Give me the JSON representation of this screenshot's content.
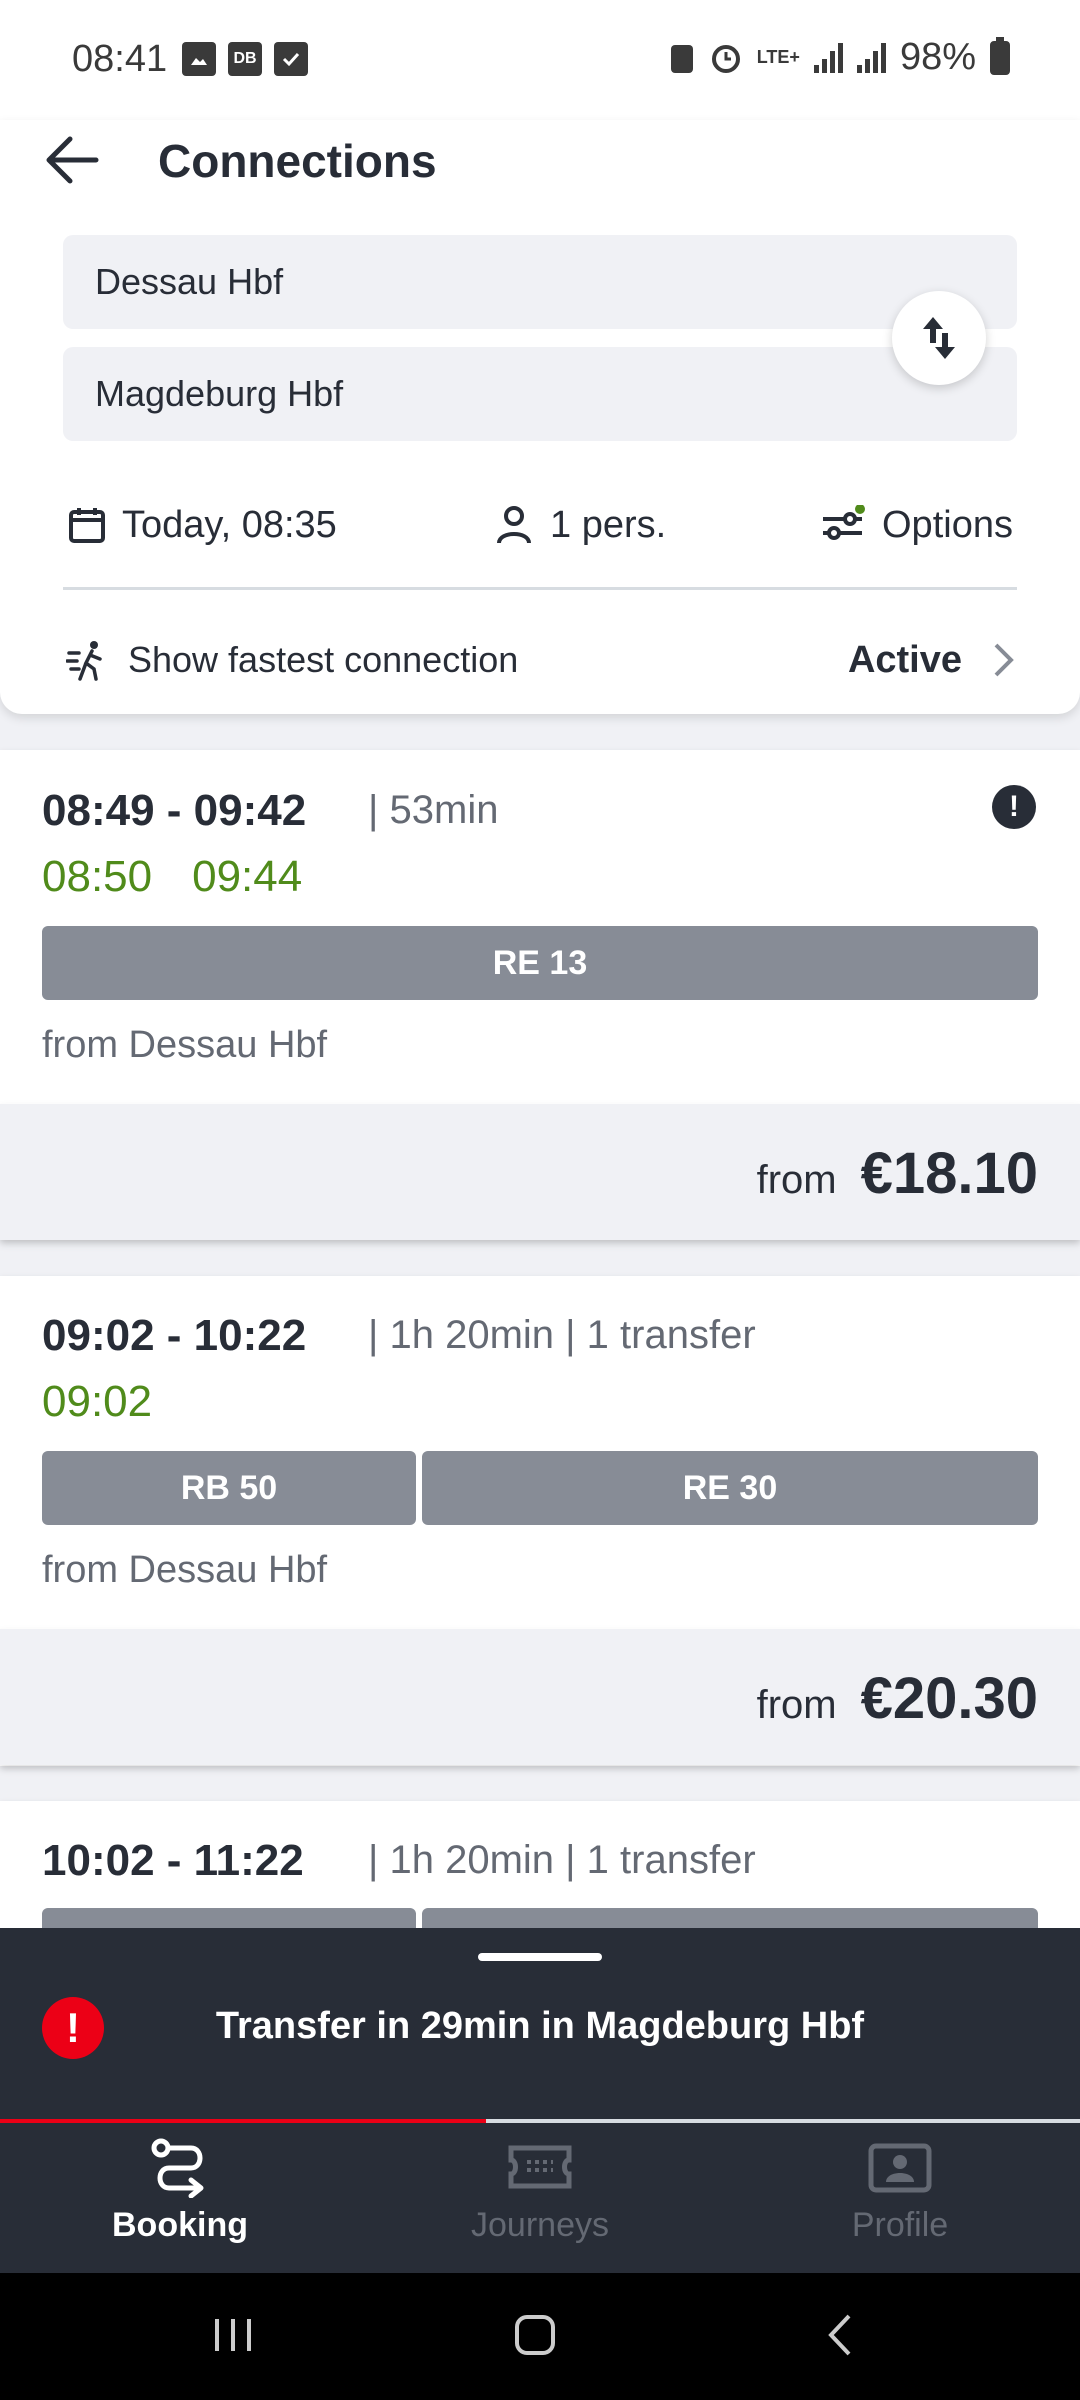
{
  "status_bar": {
    "time": "08:41",
    "left_icons": [
      "image-icon",
      "db-icon",
      "check-icon"
    ],
    "db_label": "DB",
    "network": "LTE+",
    "battery": "98%"
  },
  "header": {
    "title": "Connections",
    "from": "Dessau Hbf",
    "to": "Magdeburg Hbf",
    "date_time": "Today, 08:35",
    "passengers": "1 pers.",
    "options_label": "Options",
    "fastest_label": "Show fastest connection",
    "fastest_status": "Active"
  },
  "connections": [
    {
      "times": "08:49 - 09:42",
      "duration": "| 53min",
      "realtime_dep": "08:50",
      "realtime_arr": "09:44",
      "lines": [
        "RE 13"
      ],
      "from_station": "from Dessau Hbf",
      "price_from": "from",
      "price": "€18.10",
      "has_alert": true
    },
    {
      "times": "09:02 - 10:22",
      "duration": "| 1h 20min | 1 transfer",
      "realtime_dep": "09:02",
      "realtime_arr": "",
      "lines": [
        "RB 50",
        "RE 30"
      ],
      "from_station": "from Dessau Hbf",
      "price_from": "from",
      "price": "€20.30"
    },
    {
      "times": "10:02 - 11:22",
      "duration": "| 1h 20min | 1 transfer"
    }
  ],
  "message": {
    "text": "Transfer in 29min in Magdeburg Hbf",
    "progress": 0.45
  },
  "tabs": [
    {
      "label": "Booking",
      "icon": "route-icon",
      "active": true
    },
    {
      "label": "Journeys",
      "icon": "ticket-icon",
      "active": false
    },
    {
      "label": "Profile",
      "icon": "profile-card-icon",
      "active": false
    }
  ],
  "colors": {
    "accent_red": "#ec0016",
    "realtime_green": "#508b1b",
    "dark": "#282d37",
    "line_bar": "#878c96"
  }
}
